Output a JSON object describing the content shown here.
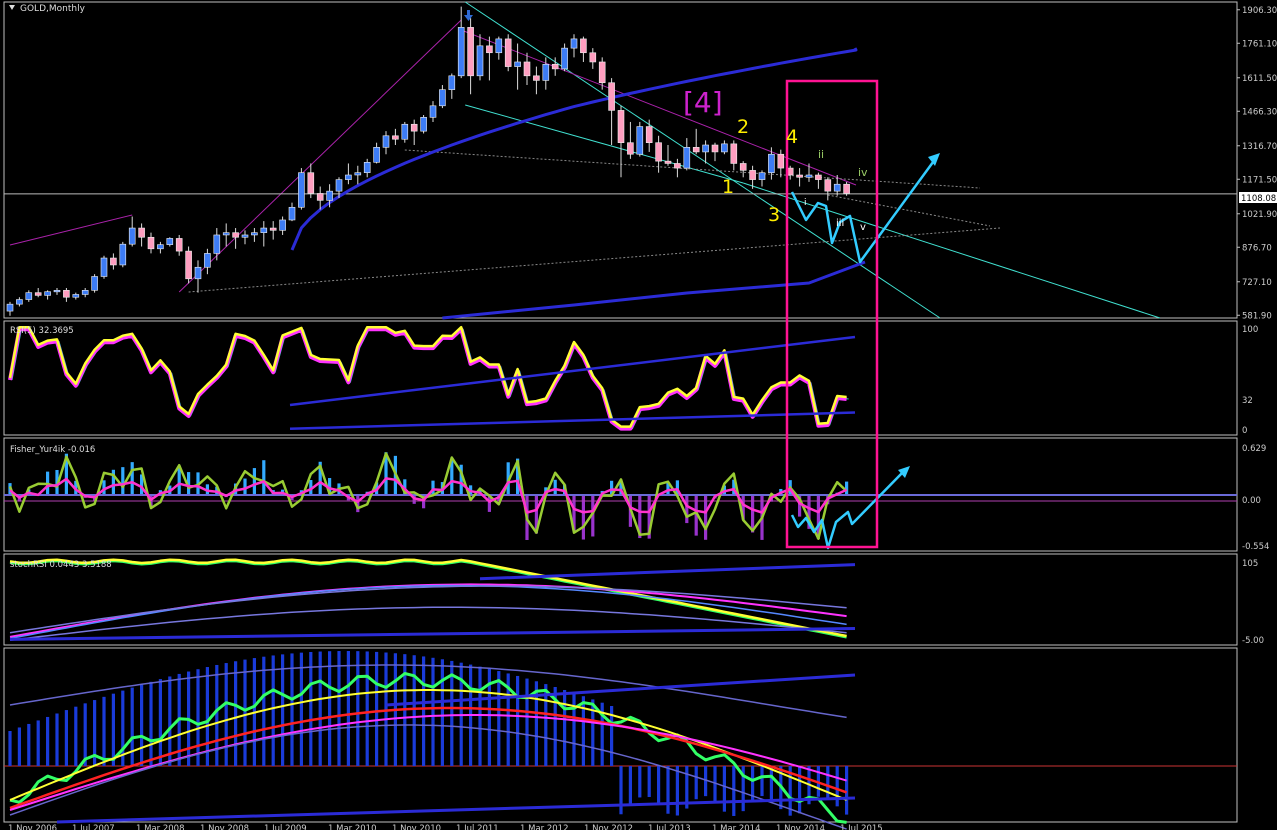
{
  "window": {
    "title": "GOLD,Monthly"
  },
  "price_panel": {
    "current_price": "1108.08",
    "wave_labels": {
      "major": "[4]",
      "w1": "1",
      "w2": "2",
      "w3": "3",
      "w4": "4",
      "sub_i": "i",
      "sub_ii": "ii",
      "sub_iii": "iii",
      "sub_iv": "iv",
      "sub_v": "v"
    }
  },
  "indicators": {
    "rsi_label": "RSI(5) 32.3695",
    "fisher_label": "Fisher_Yur4ik -0.016",
    "stoch_label": "stochRSI 0.0443 3.5188"
  },
  "time_axis": {
    "labels": [
      "1 Nov 2006",
      "1 Jul 2007",
      "1 Mar 2008",
      "1 Nov 2008",
      "1 Jul 2009",
      "1 Mar 2010",
      "1 Nov 2010",
      "1 Jul 2011",
      "1 Mar 2012",
      "1 Nov 2012",
      "1 Jul 2013",
      "1 Mar 2014",
      "1 Nov 2014",
      "1 Jul 2015"
    ]
  },
  "chart_data": [
    {
      "type": "candlestick",
      "title": "GOLD,Monthly",
      "y_ticks": [
        "1906.30",
        "1761.10",
        "1611.50",
        "1466.30",
        "1316.70",
        "1171.50",
        "1021.90",
        "876.70",
        "727.10",
        "581.90"
      ],
      "y_tick_values": [
        1906.3,
        1761.1,
        1611.5,
        1466.3,
        1316.7,
        1171.5,
        1021.9,
        876.7,
        727.1,
        581.9
      ],
      "ylim": [
        570,
        1940
      ],
      "x_axis": "months from Nov 2006",
      "last_price": 1108.08,
      "candles": [
        [
          0,
          600,
          640,
          580,
          630
        ],
        [
          1,
          630,
          660,
          620,
          650
        ],
        [
          2,
          650,
          690,
          640,
          680
        ],
        [
          3,
          680,
          700,
          660,
          668
        ],
        [
          4,
          668,
          690,
          650,
          684
        ],
        [
          5,
          684,
          700,
          670,
          690
        ],
        [
          6,
          690,
          700,
          640,
          660
        ],
        [
          7,
          660,
          680,
          650,
          672
        ],
        [
          8,
          672,
          700,
          660,
          690
        ],
        [
          9,
          690,
          760,
          680,
          750
        ],
        [
          10,
          750,
          840,
          740,
          830
        ],
        [
          11,
          830,
          850,
          780,
          800
        ],
        [
          12,
          800,
          900,
          790,
          890
        ],
        [
          13,
          890,
          1010,
          880,
          960
        ],
        [
          14,
          960,
          980,
          880,
          920
        ],
        [
          15,
          920,
          940,
          850,
          870
        ],
        [
          16,
          870,
          900,
          850,
          888
        ],
        [
          17,
          888,
          920,
          880,
          915
        ],
        [
          18,
          915,
          930,
          840,
          860
        ],
        [
          19,
          860,
          880,
          720,
          740
        ],
        [
          20,
          740,
          820,
          680,
          790
        ],
        [
          21,
          790,
          870,
          760,
          850
        ],
        [
          22,
          850,
          960,
          820,
          930
        ],
        [
          23,
          930,
          980,
          880,
          940
        ],
        [
          24,
          940,
          960,
          870,
          920
        ],
        [
          25,
          920,
          950,
          890,
          930
        ],
        [
          26,
          930,
          960,
          900,
          940
        ],
        [
          27,
          940,
          990,
          880,
          960
        ],
        [
          28,
          960,
          990,
          910,
          950
        ],
        [
          29,
          950,
          1010,
          930,
          995
        ],
        [
          30,
          995,
          1070,
          990,
          1050
        ],
        [
          31,
          1050,
          1220,
          1040,
          1200
        ],
        [
          32,
          1200,
          1240,
          1090,
          1110
        ],
        [
          33,
          1110,
          1140,
          1040,
          1080
        ],
        [
          34,
          1080,
          1150,
          1050,
          1120
        ],
        [
          35,
          1120,
          1180,
          1090,
          1170
        ],
        [
          36,
          1170,
          1240,
          1150,
          1190
        ],
        [
          37,
          1190,
          1230,
          1150,
          1200
        ],
        [
          38,
          1200,
          1260,
          1180,
          1245
        ],
        [
          39,
          1245,
          1330,
          1240,
          1310
        ],
        [
          40,
          1310,
          1380,
          1280,
          1360
        ],
        [
          41,
          1360,
          1390,
          1320,
          1345
        ],
        [
          42,
          1345,
          1420,
          1330,
          1410
        ],
        [
          43,
          1410,
          1430,
          1320,
          1380
        ],
        [
          44,
          1380,
          1450,
          1370,
          1440
        ],
        [
          45,
          1440,
          1510,
          1420,
          1490
        ],
        [
          46,
          1490,
          1580,
          1480,
          1560
        ],
        [
          47,
          1560,
          1630,
          1520,
          1620
        ],
        [
          48,
          1620,
          1920,
          1610,
          1830
        ],
        [
          49,
          1830,
          1870,
          1540,
          1620
        ],
        [
          50,
          1620,
          1800,
          1600,
          1750
        ],
        [
          51,
          1750,
          1790,
          1600,
          1720
        ],
        [
          52,
          1720,
          1790,
          1690,
          1780
        ],
        [
          53,
          1780,
          1800,
          1640,
          1660
        ],
        [
          54,
          1660,
          1760,
          1560,
          1680
        ],
        [
          55,
          1680,
          1720,
          1580,
          1620
        ],
        [
          56,
          1620,
          1660,
          1540,
          1600
        ],
        [
          57,
          1600,
          1700,
          1560,
          1670
        ],
        [
          58,
          1670,
          1700,
          1620,
          1650
        ],
        [
          59,
          1650,
          1760,
          1640,
          1740
        ],
        [
          60,
          1740,
          1800,
          1700,
          1780
        ],
        [
          61,
          1780,
          1790,
          1680,
          1720
        ],
        [
          62,
          1720,
          1740,
          1650,
          1680
        ],
        [
          63,
          1680,
          1700,
          1560,
          1590
        ],
        [
          64,
          1590,
          1610,
          1320,
          1470
        ],
        [
          65,
          1470,
          1490,
          1180,
          1330
        ],
        [
          66,
          1330,
          1420,
          1260,
          1280
        ],
        [
          67,
          1280,
          1420,
          1270,
          1400
        ],
        [
          68,
          1400,
          1430,
          1290,
          1330
        ],
        [
          69,
          1330,
          1360,
          1200,
          1250
        ],
        [
          70,
          1250,
          1320,
          1230,
          1240
        ],
        [
          71,
          1240,
          1260,
          1180,
          1220
        ],
        [
          72,
          1220,
          1350,
          1210,
          1310
        ],
        [
          73,
          1310,
          1390,
          1280,
          1290
        ],
        [
          74,
          1290,
          1340,
          1240,
          1320
        ],
        [
          75,
          1320,
          1330,
          1250,
          1290
        ],
        [
          76,
          1290,
          1340,
          1280,
          1325
        ],
        [
          77,
          1325,
          1340,
          1210,
          1240
        ],
        [
          78,
          1240,
          1250,
          1180,
          1210
        ],
        [
          79,
          1210,
          1230,
          1130,
          1170
        ],
        [
          80,
          1170,
          1210,
          1140,
          1200
        ],
        [
          81,
          1200,
          1310,
          1170,
          1280
        ],
        [
          82,
          1280,
          1300,
          1180,
          1220
        ],
        [
          83,
          1220,
          1230,
          1170,
          1190
        ],
        [
          84,
          1190,
          1220,
          1140,
          1180
        ],
        [
          85,
          1180,
          1240,
          1160,
          1190
        ],
        [
          86,
          1190,
          1200,
          1130,
          1170
        ],
        [
          87,
          1170,
          1180,
          1080,
          1120
        ],
        [
          88,
          1120,
          1190,
          1100,
          1150
        ],
        [
          89,
          1150,
          1160,
          1100,
          1110
        ]
      ]
    },
    {
      "type": "line",
      "title": "RSI(5) 32.3695",
      "y_ticks": [
        "100",
        "32",
        "0"
      ],
      "ylim": [
        0,
        100
      ],
      "current_value": 32.3695
    },
    {
      "type": "bar",
      "title": "Fisher_Yur4ik -0.016",
      "y_ticks": [
        "0.629",
        "0.00",
        "-0.554"
      ],
      "ylim": [
        -0.554,
        0.629
      ],
      "current_value": -0.016
    },
    {
      "type": "line",
      "title": "stochRSI 0.0443 3.5188",
      "y_ticks": [
        "105",
        "-5.00"
      ],
      "ylim": [
        -5,
        105
      ]
    },
    {
      "type": "area",
      "title": "",
      "y_ticks": []
    }
  ],
  "colors": {
    "bull": "#3d7cf5",
    "bear": "#ff9ec0",
    "grid": "#c0c0c0",
    "rsi_main": "#ffff33",
    "rsi_shadow": "#ff33ff",
    "fisher_up": "#33aaff",
    "fisher_down": "#9933cc",
    "fisher_line": "#99cc33",
    "fisher_mag": "#ff33cc",
    "channel": "#40e0d0",
    "box": "#ff1493",
    "arrow": "#33ccff",
    "ma_blue": "#2b2bd6",
    "wave_yellow": "#ffee00",
    "wave_major": "#cc22cc"
  }
}
